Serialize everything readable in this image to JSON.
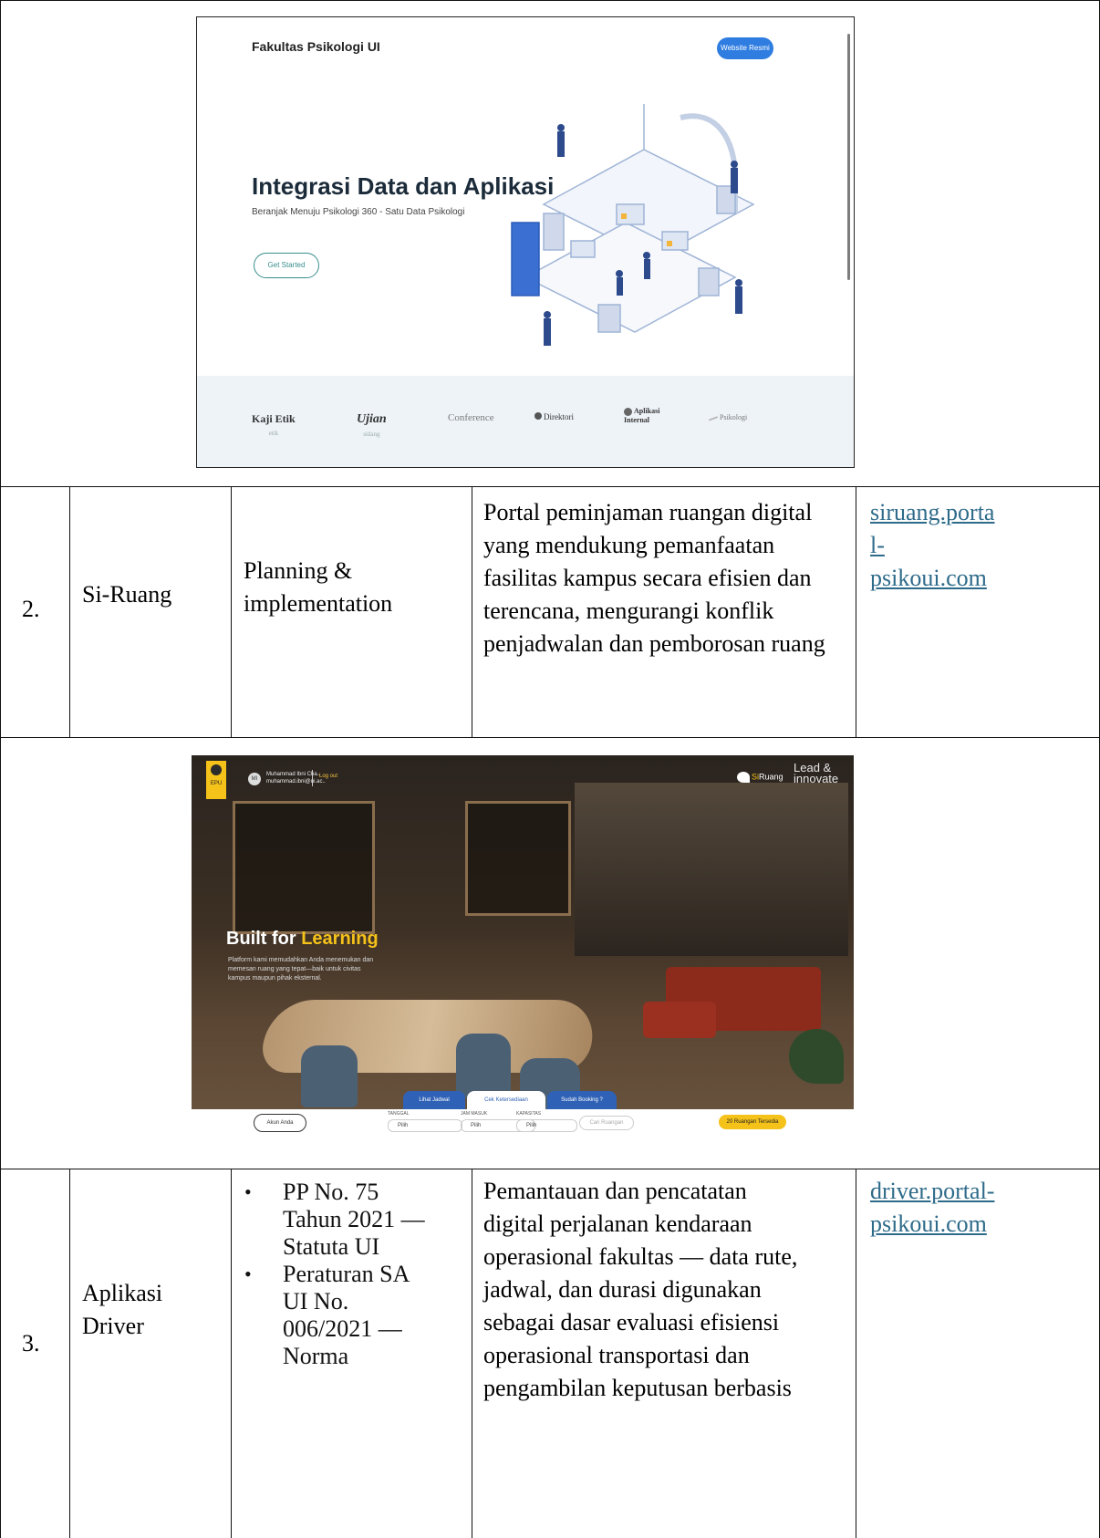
{
  "shot1": {
    "brand": "Fakultas Psikologi UI",
    "website_button": "Website Resmi",
    "hero_title": "Integrasi Data dan Aplikasi",
    "hero_subtitle": "Beranjak Menuju Psikologi 360 - Satu Data Psikologi",
    "get_started": "Get Started",
    "apps": [
      {
        "label": "Kaji Etik",
        "sub": "etik"
      },
      {
        "label": "Ujian",
        "sub": "sidang"
      },
      {
        "label": "Conference",
        "sub": ""
      },
      {
        "label": "Direktori",
        "sub": ""
      },
      {
        "label": "Aplikasi Internal",
        "sub": ""
      },
      {
        "label": "Psikologi",
        "sub": ""
      }
    ]
  },
  "row2": {
    "number": "2.",
    "name": "Si-Ruang",
    "regulation": "Planning & implementation",
    "description": "Portal peminjaman ruangan digital yang mendukung pemanfaatan fasilitas kampus secara efisien dan terencana, mengurangi konflik penjadwalan dan pemborosan ruang",
    "link_lines": [
      "siruang.porta",
      "l-",
      "psikoui.com"
    ]
  },
  "shot2": {
    "badge": "EPU",
    "avatar": "MI",
    "user_name": "Muhammad Ibni Cha..",
    "user_email": "muhammad.ibni@ui.ac..",
    "logout": "Log out",
    "logo_si": "Si",
    "logo_ruang": "Ruang",
    "lead_line1": "Lead &",
    "lead_line2": "innovate",
    "hero_title_plain": "Built for ",
    "hero_title_accent": "Learning",
    "hero_desc": "Platform kami memudahkan Anda menemukan dan memesan ruang yang tepat—baik untuk civitas kampus maupun pihak eksternal.",
    "tabs": [
      "Lihat Jadwal",
      "Cek Ketersediaan",
      "Sudah Booking ?"
    ],
    "account_button": "Akun Anda",
    "fields": [
      {
        "label": "TANGGAL",
        "value": "Pilih"
      },
      {
        "label": "JAM MASUK",
        "value": "Pilih"
      },
      {
        "label": "KAPASITAS",
        "value": "Pilih"
      }
    ],
    "search_button": "Cari Ruangan",
    "rooms_button": "20 Ruangan Tersedia"
  },
  "row3": {
    "number": "3.",
    "name_line1": "Aplikasi",
    "name_line2": "Driver",
    "bullets": [
      [
        "PP No. 75",
        "Tahun 2021 —",
        "Statuta UI"
      ],
      [
        "Peraturan SA",
        "UI No.",
        "006/2021 —",
        "Norma"
      ]
    ],
    "description_lines": [
      "Pemantauan dan pencatatan",
      "digital perjalanan kendaraan",
      "operasional fakultas — data rute,",
      "jadwal, dan durasi digunakan",
      "sebagai dasar evaluasi efisiensi",
      "operasional transportasi dan",
      "pengambilan keputusan berbasis"
    ],
    "link_lines": [
      "driver.portal-",
      "psikoui.com"
    ]
  }
}
